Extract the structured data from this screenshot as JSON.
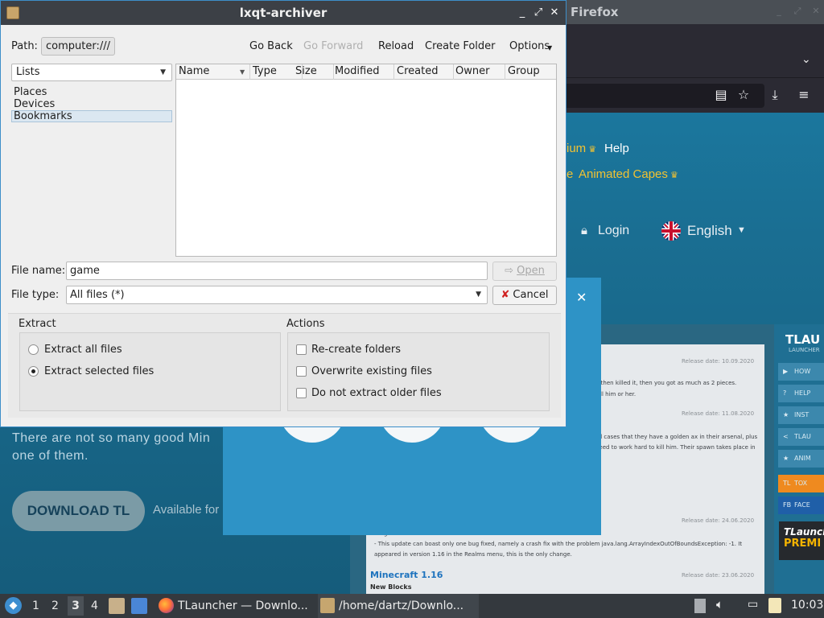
{
  "firefox": {
    "window_title": "Firefox",
    "nav_premium": "ium",
    "nav_help": "Help",
    "nav_e": "e",
    "nav_capes": "Animated Capes",
    "login": "Login",
    "language": "English",
    "hero_line1": "There are not so many good Min",
    "hero_line2": "one of them.",
    "download_button": "DOWNLOAD TL",
    "available": "Available for",
    "news": {
      "dates": [
        "Release date: 10.09.2020",
        "Release date: 11.08.2020",
        "Release date: 24.06.2020",
        "Release date: 23.06.2020"
      ],
      "lines": [
        "d then killed it, then you got as much as 2 pieces.",
        "kill him or her.",
        "all cases that they have a golden ax in their arsenal, plus",
        "need to work hard to kill him. Their spawn takes place in",
        "- This update can boast only one bug fixed, namely a crash fix with the problem java.lang.ArrayIndexOutOfBoundsException: -1. It",
        "appeared in version 1.16 in the Realms menu, this is the only change."
      ],
      "changes": "changes",
      "mc_version": "Minecraft 1.16",
      "new_blocks": "New Blocks"
    },
    "sidebar": {
      "logo": "TLAU",
      "sub": "LAUNCHER",
      "items": [
        "HOW",
        "HELP",
        "INST",
        "TLAU",
        "ANIM",
        "TOX",
        "FACE"
      ],
      "tl_badge": "TL",
      "fb_badge": "FB",
      "premium_top": "TLaunch",
      "premium_bottom": "PREMI"
    }
  },
  "dialog": {
    "title": "lxqt-archiver",
    "path_label": "Path:",
    "path_value": "computer:///",
    "toolbar": {
      "go_back": "Go Back",
      "go_forward": "Go Forward",
      "reload": "Reload",
      "create_folder": "Create Folder",
      "options": "Options"
    },
    "lists_combo": "Lists",
    "places": [
      "Places",
      "Devices",
      "Bookmarks"
    ],
    "columns": [
      "Name",
      "Type",
      "Size",
      "Modified",
      "Created",
      "Owner",
      "Group"
    ],
    "file_name_label": "File name:",
    "file_name_value": "game",
    "open_button": "Open",
    "file_type_label": "File type:",
    "file_type_value": "All files (*)",
    "cancel_button": "Cancel",
    "extract_title": "Extract",
    "extract_all": "Extract all files",
    "extract_selected": "Extract selected files",
    "actions_title": "Actions",
    "recreate_folders": "Re-create folders",
    "overwrite_existing": "Overwrite existing files",
    "no_older": "Do not extract older files"
  },
  "taskbar": {
    "desktops": [
      "1",
      "2",
      "3",
      "4"
    ],
    "task_firefox": "TLauncher — Downlo...",
    "task_archiver": "/home/dartz/Downlo...",
    "clock": "10:03"
  }
}
